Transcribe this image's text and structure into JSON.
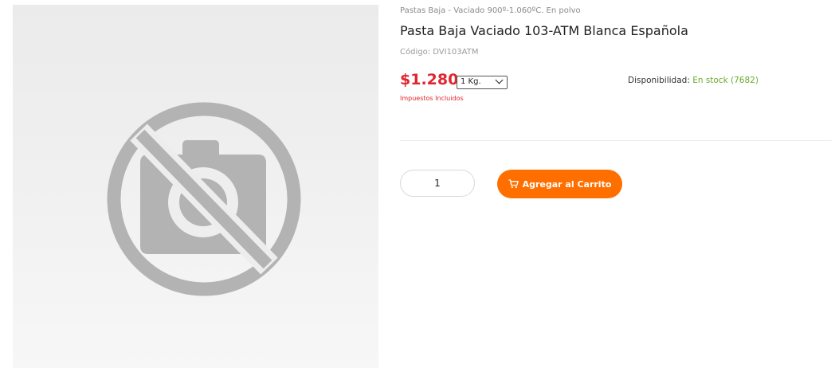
{
  "product": {
    "category": "Pastas Baja - Vaciado 900º-1.060ºC. En polvo",
    "title": "Pasta Baja Vaciado 103-ATM Blanca Española",
    "sku_label": "Código:",
    "sku_value": "DVI103ATM",
    "price": "$1.280",
    "unit_selected": "1 Kg.",
    "tax_note": "Impuestos Incluidos",
    "availability_label": "Disponibilidad:",
    "availability_value": "En stock (7682)",
    "quantity": "1",
    "add_to_cart_label": "Agregar al Carrito",
    "image_icon": "no-camera-placeholder-icon"
  },
  "colors": {
    "price": "#e0262f",
    "stock": "#6aab2b",
    "cart_button": "#ff6f00",
    "placeholder_icon": "#b3b3b3"
  }
}
